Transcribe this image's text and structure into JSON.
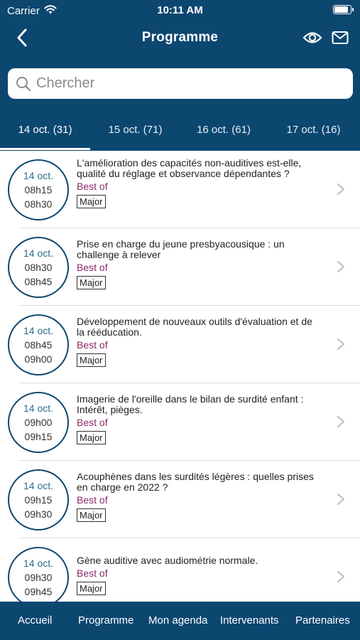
{
  "status_bar": {
    "carrier": "Carrier",
    "time": "10:11 AM"
  },
  "navbar": {
    "title": "Programme"
  },
  "search": {
    "placeholder": "Chercher"
  },
  "tabs": [
    {
      "label": "14 oct. (31)",
      "active": true
    },
    {
      "label": "15 oct. (71)",
      "active": false
    },
    {
      "label": "16 oct. (61)",
      "active": false
    },
    {
      "label": "17 oct. (16)",
      "active": false
    }
  ],
  "sessions": [
    {
      "date": "14 oct.",
      "start": "08h15",
      "end": "08h30",
      "title": "L'amélioration des capacités non-auditives est-elle, qualité du réglage et observance dépendantes ?",
      "category": "Best of",
      "tag": "Major"
    },
    {
      "date": "14 oct.",
      "start": "08h30",
      "end": "08h45",
      "title": "Prise en charge du jeune presbyacousique : un challenge à relever",
      "category": "Best of",
      "tag": "Major"
    },
    {
      "date": "14 oct.",
      "start": "08h45",
      "end": "09h00",
      "title": "Développement de nouveaux outils d'évaluation et de la rééducation.",
      "category": "Best of",
      "tag": "Major"
    },
    {
      "date": "14 oct.",
      "start": "09h00",
      "end": "09h15",
      "title": "Imagerie de l'oreille dans le bilan de surdité enfant : Intérêt, pièges.",
      "category": "Best of",
      "tag": "Major"
    },
    {
      "date": "14 oct.",
      "start": "09h15",
      "end": "09h30",
      "title": "Acouphènes dans les surdités légères : quelles prises en charge en 2022 ?",
      "category": "Best of",
      "tag": "Major"
    },
    {
      "date": "14 oct.",
      "start": "09h30",
      "end": "09h45",
      "title": "Gène auditive avec audiométrie normale.",
      "category": "Best of",
      "tag": "Major"
    }
  ],
  "tabbar": [
    {
      "label": "Accueil"
    },
    {
      "label": "Programme"
    },
    {
      "label": "Mon agenda"
    },
    {
      "label": "Intervenants"
    },
    {
      "label": "Partenaires"
    }
  ],
  "colors": {
    "brand": "#0c4770",
    "category": "#8a2a6a",
    "date": "#2a6d8f"
  },
  "icons": [
    "wifi-icon",
    "battery-icon",
    "back-chevron-icon",
    "eye-icon",
    "mail-icon",
    "search-icon",
    "chevron-right-icon"
  ]
}
